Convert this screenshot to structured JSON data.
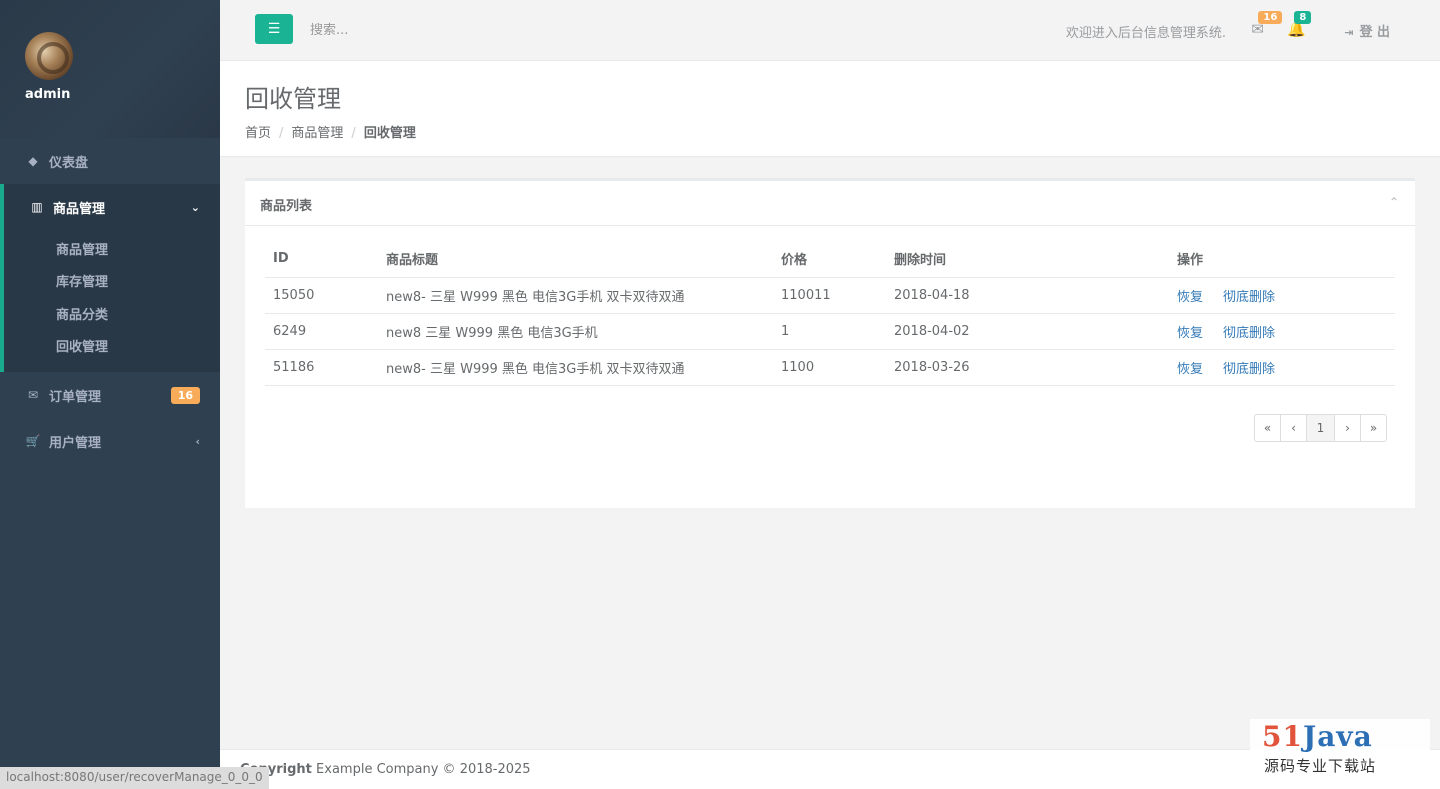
{
  "sidebar": {
    "username": "admin",
    "items": [
      {
        "label": "仪表盘",
        "icon": "diamond-icon"
      },
      {
        "label": "商品管理",
        "icon": "bar-chart-icon"
      },
      {
        "label": "订单管理",
        "icon": "envelope-icon",
        "badge": "16"
      },
      {
        "label": "用户管理",
        "icon": "cart-icon"
      }
    ],
    "submenu": [
      "商品管理",
      "库存管理",
      "商品分类",
      "回收管理"
    ]
  },
  "topbar": {
    "search_placeholder": "搜索...",
    "welcome": "欢迎进入后台信息管理系统.",
    "mail_badge": "16",
    "bell_badge": "8",
    "logout": "登 出"
  },
  "heading": {
    "title": "回收管理",
    "breadcrumb": [
      "首页",
      "商品管理",
      "回收管理"
    ]
  },
  "panel": {
    "title": "商品列表",
    "columns": [
      "ID",
      "商品标题",
      "价格",
      "删除时间",
      "操作"
    ],
    "rows": [
      {
        "id": "15050",
        "title": "new8- 三星 W999 黑色 电信3G手机 双卡双待双通",
        "price": "110011",
        "deleted": "2018-04-18"
      },
      {
        "id": "6249",
        "title": "new8 三星 W999 黑色 电信3G手机",
        "price": "1",
        "deleted": "2018-04-02"
      },
      {
        "id": "51186",
        "title": "new8- 三星 W999 黑色 电信3G手机 双卡双待双通",
        "price": "1100",
        "deleted": "2018-03-26"
      }
    ],
    "action_restore": "恢复",
    "action_delete": "彻底删除",
    "pagination": [
      "«",
      "‹",
      "1",
      "›",
      "»"
    ]
  },
  "footer": {
    "copyright_label": "Copyright",
    "copyright_text": "Example Company © 2018-2025"
  },
  "statusbar": {
    "url": "localhost:8080/user/recoverManage_0_0_0"
  },
  "watermark": {
    "digits": "51",
    "word": "Java",
    "tagline": "源码专业下载站"
  },
  "colors": {
    "sidebar_bg": "#2f4050",
    "accent": "#1ab394",
    "warning": "#f8ac59",
    "link": "#337ab7"
  }
}
